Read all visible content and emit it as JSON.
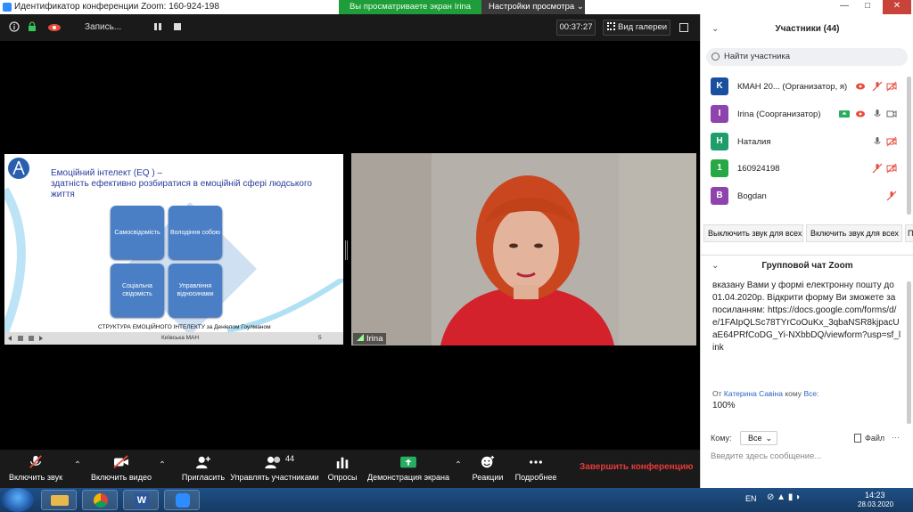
{
  "titlebar": {
    "title": "Идентификатор конференции Zoom: 160-924-198",
    "min": "—",
    "max": "□",
    "close": "✕"
  },
  "view_banner": {
    "label": "Вы просматриваете экран Irina",
    "options": "Настройки просмотра ⌄"
  },
  "meeting_top": {
    "recording": "Запись...",
    "timer": "00:37:27",
    "gallery": "Вид галереи"
  },
  "slide": {
    "title_line1": "Емоційний інтелект (EQ ) –",
    "title_line2": "здатність ефективно розбиратися в емоційній сфері людського",
    "title_line3": "життя",
    "boxes": [
      "Самосвідомість",
      "Володіння собою",
      "Соціальна свідомість",
      "Управління відносинами"
    ],
    "caption": "СТРУКТУРА ЕМОЦІЙНОГО ІНТЕЛЕКТУ за Деніелом Гоулманом",
    "org": "Київська МАН",
    "page": "5"
  },
  "video": {
    "name": "Irina"
  },
  "toolbar": {
    "audio": "Включить звук",
    "video": "Включить видео",
    "invite": "Пригласить",
    "participants": "Управлять участниками",
    "participants_count": "44",
    "polls": "Опросы",
    "share": "Демонстрация экрана",
    "reactions": "Реакции",
    "more": "Подробнее",
    "end": "Завершить конференцию"
  },
  "participants_panel": {
    "title": "Участники (44)",
    "search_placeholder": "Найти участника",
    "rows": [
      {
        "initial": "K",
        "name": "КМАН 20...  (Организатор, я)",
        "color": "#1a4fa0"
      },
      {
        "initial": "I",
        "name": "Irina (Соорганизатор)",
        "color": "#8e44ad"
      },
      {
        "initial": "Н",
        "name": "Наталия",
        "color": "#1e9e6a"
      },
      {
        "initial": "1",
        "name": "160924198",
        "color": "#27a844"
      },
      {
        "initial": "B",
        "name": "Bogdan",
        "color": "#8e44ad"
      }
    ],
    "mute_all_1": "Выключить звук для всех",
    "mute_all_2": "Включить звук для всех",
    "more_btn": "П"
  },
  "chat": {
    "title": "Групповой чат Zoom",
    "message": "вказану Вами у формі електронну пошту до 01.04.2020р. Відкрити форму Ви зможете за посиланням: https://docs.google.com/forms/d/e/1FAIpQLSc78TYrCoOuKx_3qbaNSR8kjpacUaE64PRfCoDG_Yi-NXbbDQ/viewform?usp=sf_link",
    "from_prefix": "От",
    "from_name": "Катерина Савіна",
    "to_word": "кому",
    "to_name": "Все:",
    "last_message": "100%",
    "to_label": "Кому:",
    "to_value": "Все",
    "file": "Файл",
    "input_placeholder": "Введите здесь сообщение..."
  },
  "taskbar": {
    "lang": "EN",
    "time": "14:23",
    "date": "28.03.2020"
  }
}
